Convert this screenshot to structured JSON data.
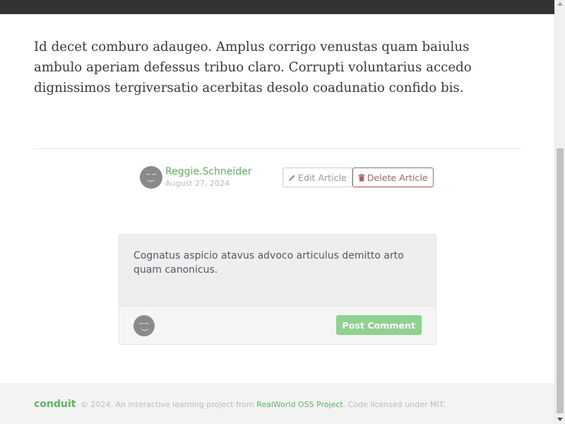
{
  "article": {
    "body": "Id decet comburo adaugeo. Amplus corrigo venustas quam baiulus ambulo aperiam defessus tribuo claro. Corrupti voluntarius accedo dignissimos tergiversatio acerbitas desolo coadunatio confido bis."
  },
  "article_meta": {
    "author": "Reggie.Schneider",
    "date": "August 27, 2024",
    "edit_label": "Edit Article",
    "delete_label": "Delete Article",
    "edit_icon": "pencil-icon",
    "delete_icon": "trash-icon"
  },
  "comment_form": {
    "text": "Cognatus aspicio atavus advoco articulus demitto arto quam canonicus.",
    "post_label": "Post Comment"
  },
  "footer": {
    "logo": "conduit",
    "prefix": "© 2024. An interactive learning project from ",
    "link": "RealWorld OSS Project",
    "suffix": ". Code licensed under MIT."
  },
  "colors": {
    "brand": "#5cb85c",
    "danger": "#b85c5c",
    "topbar": "#333333"
  }
}
